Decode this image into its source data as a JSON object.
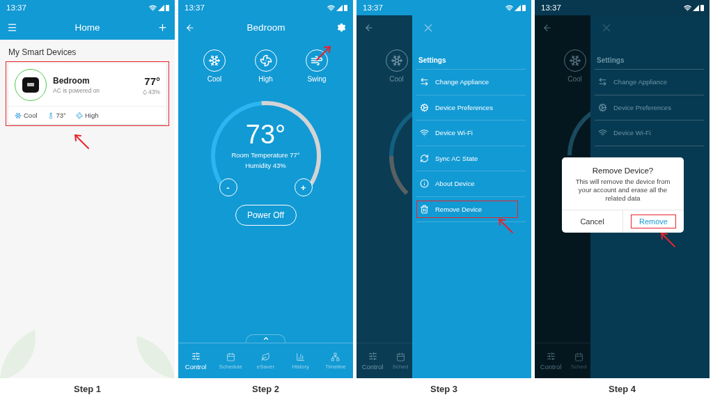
{
  "steps": [
    {
      "kind": "home",
      "caption": "Step 1",
      "time": "13:37",
      "title": "Home",
      "section": "My Smart Devices",
      "device": {
        "name": "Bedroom",
        "status": "AC is powered on",
        "temperature": "77°",
        "humidity": "43%",
        "mode": "Cool",
        "setpoint": "73°",
        "fan": "High",
        "highlighted": true
      }
    },
    {
      "kind": "control",
      "caption": "Step 2",
      "time": "13:37",
      "title": "Bedroom",
      "modes": [
        {
          "label": "Cool"
        },
        {
          "label": "High"
        },
        {
          "label": "Swing"
        }
      ],
      "setpoint": "73°",
      "room_temperature": "Room Temperature 77°",
      "humidity": "Humidity 43%",
      "decrease": "-",
      "increase": "+",
      "power": "Power Off",
      "tabs": [
        {
          "label": "Control",
          "selected": true
        },
        {
          "label": "Schedule",
          "selected": false
        },
        {
          "label": "eSaver",
          "selected": false
        },
        {
          "label": "History",
          "selected": false
        },
        {
          "label": "Timeline",
          "selected": false
        }
      ]
    },
    {
      "kind": "settings",
      "caption": "Step 3",
      "time": "13:37",
      "background": {
        "mode": "Cool",
        "tabs": [
          {
            "label": "Control",
            "selected": true
          },
          {
            "label": "Sched",
            "selected": false
          }
        ]
      },
      "drawer": {
        "heading": "Settings",
        "items": [
          {
            "label": "Change Appliance",
            "highlighted": false
          },
          {
            "label": "Device Preferences",
            "highlighted": false
          },
          {
            "label": "Device Wi-Fi",
            "highlighted": false
          },
          {
            "label": "Sync AC State",
            "highlighted": false
          },
          {
            "label": "About Device",
            "highlighted": false
          },
          {
            "label": "Remove Device",
            "highlighted": true
          }
        ]
      }
    },
    {
      "kind": "confirm",
      "caption": "Step 4",
      "time": "13:37",
      "background": {
        "mode": "Cool",
        "tabs": [
          {
            "label": "Control",
            "selected": true
          },
          {
            "label": "Sched",
            "selected": false
          }
        ]
      },
      "drawer": {
        "heading": "Settings",
        "items": [
          {
            "label": "Change Appliance",
            "highlighted": false
          },
          {
            "label": "Device Preferences",
            "highlighted": false
          },
          {
            "label": "Device Wi-Fi",
            "highlighted": false
          }
        ]
      },
      "dialog": {
        "title": "Remove Device?",
        "message": "This will remove the device from your account and erase all the related data",
        "buttons": [
          {
            "label": "Cancel",
            "highlighted": false
          },
          {
            "label": "Remove",
            "highlighted": true
          }
        ]
      }
    }
  ]
}
